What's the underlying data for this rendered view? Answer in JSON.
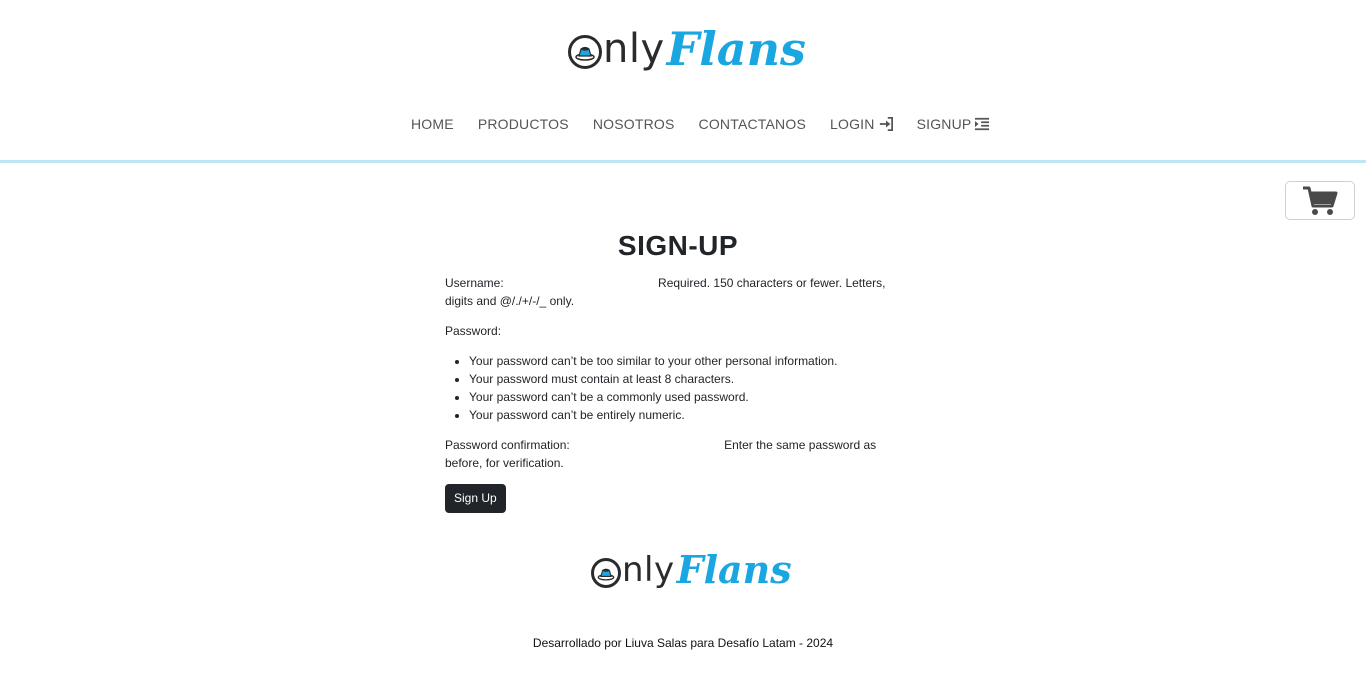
{
  "brand": {
    "logo_only": "nly",
    "logo_flans": "Flans"
  },
  "nav": {
    "items": [
      {
        "label": "HOME",
        "icon": ""
      },
      {
        "label": "PRODUCTOS",
        "icon": ""
      },
      {
        "label": "NOSOTROS",
        "icon": ""
      },
      {
        "label": "CONTACTANOS",
        "icon": ""
      },
      {
        "label": "LOGIN",
        "icon": "sign-in-icon"
      },
      {
        "label": "SIGNUP",
        "icon": "indent-icon"
      }
    ]
  },
  "cart": {
    "icon": "shopping-cart-icon"
  },
  "form": {
    "title": "SIGN-UP",
    "username_label": "Username:",
    "username_help": "Required. 150 characters or fewer. Letters, digits and @/./+/-/_ only.",
    "password_label": "Password:",
    "password_rules": [
      "Your password can’t be too similar to your other personal information.",
      "Your password must contain at least 8 characters.",
      "Your password can’t be a commonly used password.",
      "Your password can’t be entirely numeric."
    ],
    "confirm_label": "Password confirmation:",
    "confirm_help": "Enter the same password as before, for verification.",
    "submit_label": "Sign Up"
  },
  "footer": {
    "credit": "Desarrollado por Liuva Salas para Desafío Latam - 2024"
  },
  "colors": {
    "accent": "#1aa6e0",
    "header_border": "#bfe6f5",
    "button_bg": "#212529"
  }
}
